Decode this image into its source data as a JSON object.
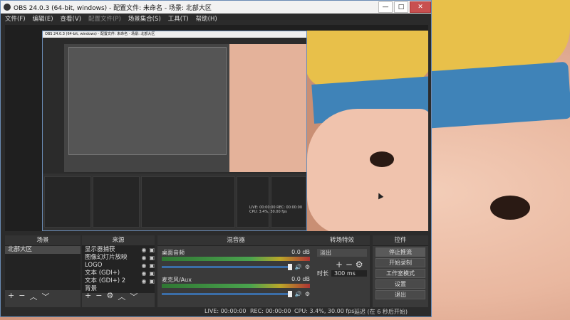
{
  "window": {
    "title": "OBS 24.0.3 (64-bit, windows) - 配置文件: 未命名 - 场景: 北部大区",
    "controls": [
      "—",
      "□",
      "✕"
    ]
  },
  "menu": [
    "文件(F)",
    "编辑(E)",
    "查看(V)",
    "配置文件(P)",
    "场景集合(S)",
    "工具(T)",
    "帮助(H)"
  ],
  "nested_title": "OBS 24.0.3 (64-bit, windows) - 配置文件: 未命名 - 场景: 北部大区",
  "nested_status": "LIVE: 00:00:00   REC: 00:00:00   CPU: 3.4%, 30.00 fps",
  "docks": {
    "scenes": {
      "header": "场景",
      "items": [
        "北部大区"
      ]
    },
    "sources": {
      "header": "来源",
      "items": [
        "显示器捕获",
        "图像幻灯片放映",
        "LOGO",
        "文本 (GDI+)",
        "文本 (GDI+) 2",
        "背景"
      ]
    },
    "mixer": {
      "header": "混音器",
      "channels": [
        {
          "name": "桌面音频",
          "db": "0.0 dB"
        },
        {
          "name": "麦克风/Aux",
          "db": "0.0 dB"
        }
      ]
    },
    "transitions": {
      "header": "转场特效",
      "type": "淡出",
      "duration_label": "时长",
      "duration_value": "300 ms"
    },
    "controls": {
      "header": "控件",
      "buttons": [
        "停止推流",
        "开始录制",
        "工作室模式",
        "设置",
        "退出"
      ]
    }
  },
  "toolbar_icons": [
    "plus-icon",
    "minus-icon",
    "up-icon",
    "down-icon",
    "gear-icon"
  ],
  "status": {
    "live": "LIVE: 00:00:00",
    "rec": "REC: 00:00:00",
    "cpu": "CPU: 3.4%, 30.00 fps",
    "delay": "延迟 (在 6 秒后开始)"
  }
}
